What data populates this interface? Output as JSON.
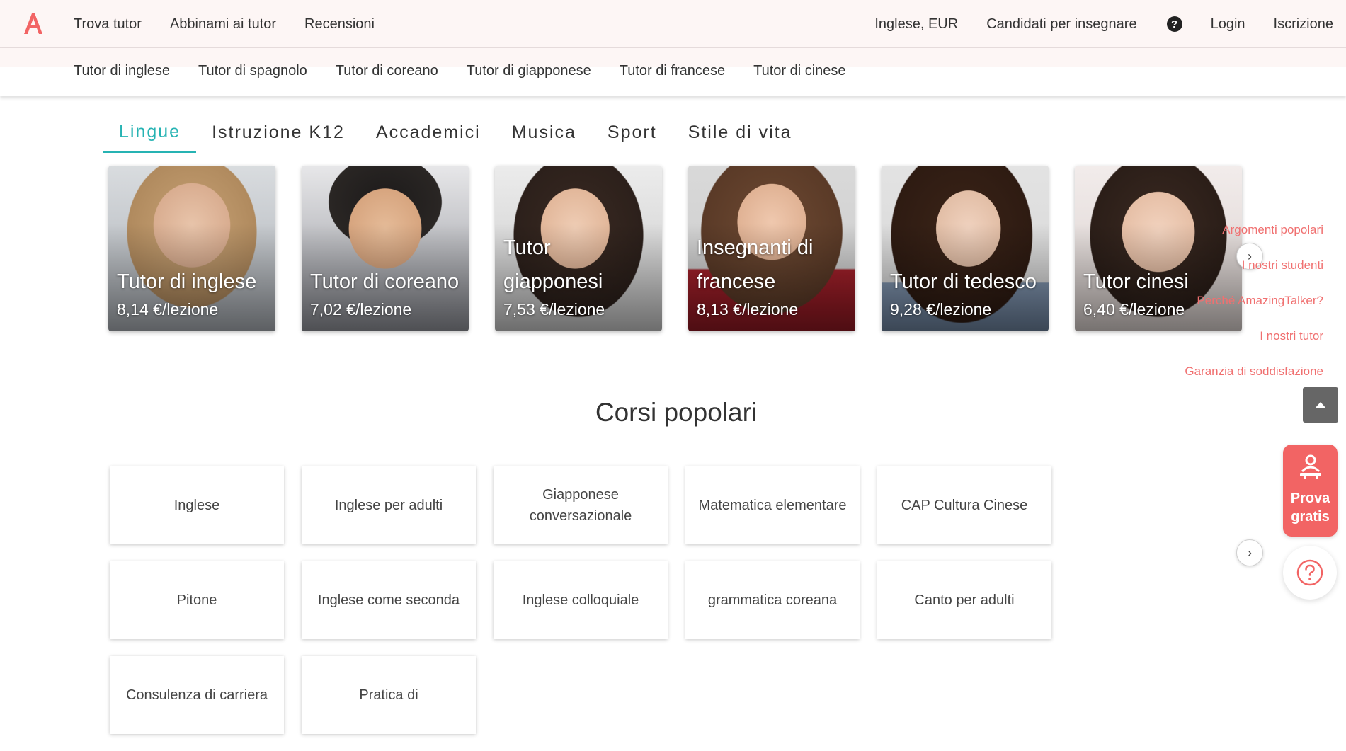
{
  "header": {
    "nav_left": [
      "Trova tutor",
      "Abbinami ai tutor",
      "Recensioni"
    ],
    "language_currency": "Inglese, EUR",
    "teach_link": "Candidati per insegnare",
    "login": "Login",
    "signup": "Iscrizione",
    "brand_color": "#f26464"
  },
  "subnav": {
    "items": [
      "Tutor di inglese",
      "Tutor di spagnolo",
      "Tutor di coreano",
      "Tutor di giapponese",
      "Tutor di francese",
      "Tutor di cinese"
    ]
  },
  "category_tabs": {
    "items": [
      "Lingue",
      "Istruzione K12",
      "Accademici",
      "Musica",
      "Sport",
      "Stile di vita"
    ],
    "active": "Lingue",
    "accent_color": "#26b3b3"
  },
  "tutor_cards": [
    {
      "title": "Tutor di inglese",
      "price": "8,14 €/lezione"
    },
    {
      "title": "Tutor di coreano",
      "price": "7,02 €/lezione"
    },
    {
      "title": "Tutor giapponesi",
      "price": "7,53 €/lezione"
    },
    {
      "title": "Insegnanti di francese",
      "price": "8,13 €/lezione"
    },
    {
      "title": "Tutor di tedesco",
      "price": "9,28 €/lezione"
    },
    {
      "title": "Tutor cinesi",
      "price": "6,40 €/lezione"
    }
  ],
  "side_menu": {
    "items": [
      "Argomenti popolari",
      "I nostri studenti",
      "Perché AmazingTalker?",
      "I nostri tutor",
      "Garanzia di soddisfazione"
    ],
    "color": "#f07070"
  },
  "trial_button": {
    "label": "Prova gratis"
  },
  "popular_courses": {
    "title": "Corsi popolari",
    "items": [
      "Inglese",
      "Inglese per adulti",
      "Giapponese conversazionale",
      "Matematica elementare",
      "CAP Cultura Cinese",
      "Pitone",
      "Inglese come seconda",
      "Inglese colloquiale",
      "grammatica coreana",
      "Canto per adulti",
      "Consulenza di carriera",
      "Pratica di"
    ]
  }
}
